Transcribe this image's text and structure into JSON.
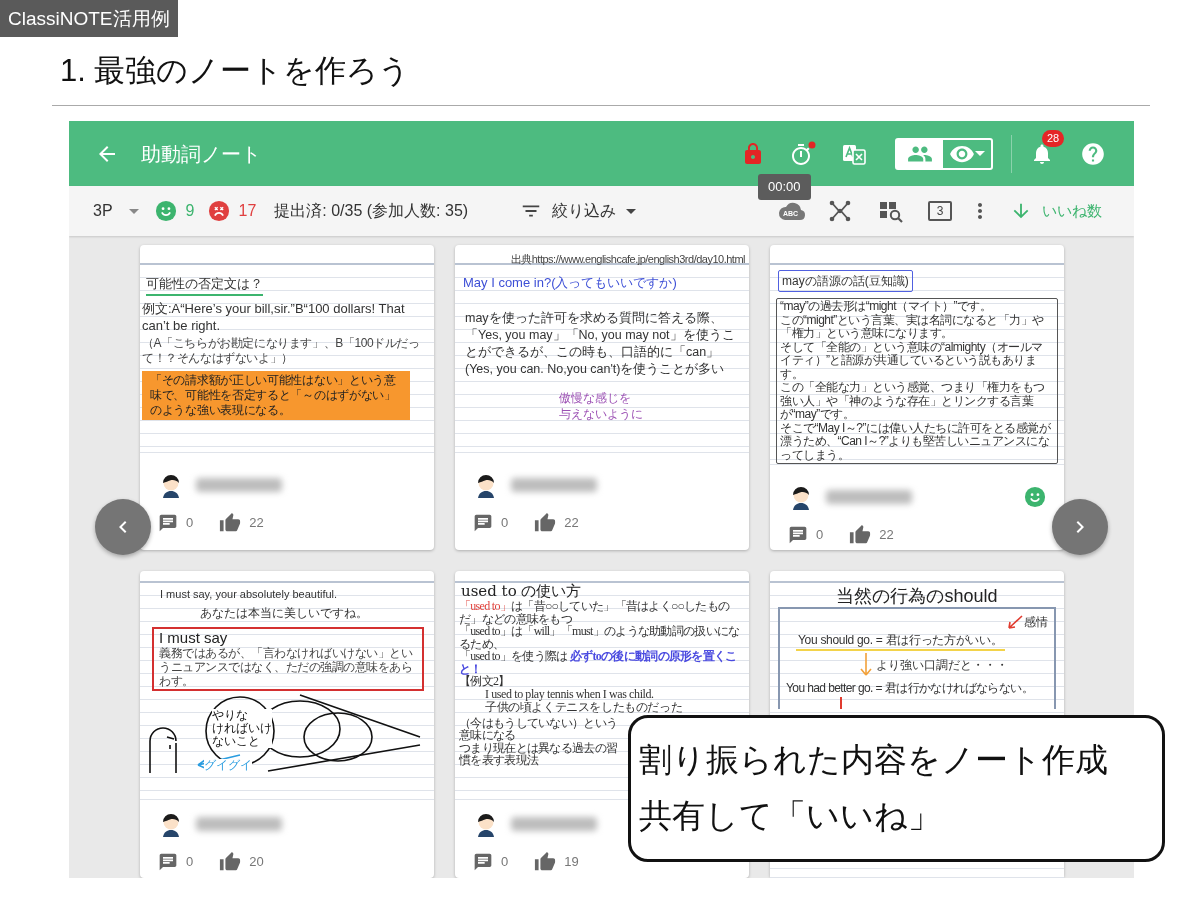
{
  "slide": {
    "tag": "ClassiNOTE活用例",
    "title": "1. 最強のノートを作ろう"
  },
  "app": {
    "header": {
      "title": "助動詞ノート",
      "view_toggle": [
        {
          "kind": "group",
          "selected": true
        },
        {
          "kind": "eye",
          "selected": false
        }
      ],
      "notifications": "28"
    },
    "tooltip": "00:00",
    "toolbar": {
      "class": "3P",
      "good_count": "9",
      "bad_count": "17",
      "submitted": "提出済: 0/35 (参加人数: 35)",
      "filter": "絞り込み",
      "cloud_label": "ABC",
      "page_count": "3",
      "sort": "いいね数"
    },
    "cards": [
      {
        "note": [
          {
            "kind": "heading-green",
            "text": "可能性の否定文は？"
          },
          {
            "kind": "body",
            "text": "例文:A“Here’s your bill,sir.”B“100 dollars! That can’t be right."
          },
          {
            "kind": "small",
            "text": "（A「こちらがお勘定になります」、B「100ドルだって！？そんなはずないよ」）"
          },
          {
            "kind": "highlight",
            "text": "「その請求額が正しい可能性はない」という意味で、可能性を否定すると「～のはずがない」のような強い表現になる。"
          }
        ],
        "footer": {
          "comments": "0",
          "likes": "22",
          "good_mark": false
        }
      },
      {
        "note": [
          {
            "kind": "source",
            "text": "出典https://www.englishcafe.jp/english3rd/day10.html"
          },
          {
            "kind": "heading-blue",
            "text": "May I come in?(入ってもいいですか)"
          },
          {
            "kind": "body-spaced",
            "text": "mayを使った許可を求める質問に答える際、「Yes, you may」「No, you may not」を使うことができるが、この時も、口語的に「can」(Yes, you can. No,you can't)を使うことが多い"
          },
          {
            "kind": "aside",
            "lines": [
              "傲慢な感じを",
              "与えないように"
            ]
          }
        ],
        "footer": {
          "comments": "0",
          "likes": "22",
          "good_mark": false
        }
      },
      {
        "note": [
          {
            "kind": "tag",
            "text": "mayの語源の話(豆知識)"
          },
          {
            "kind": "framed",
            "lines": [
              "“may”の過去形は“might（マイト）”です。",
              "この“might”という言葉、実は名詞になると「力」や「権力」という意味になります。",
              "そして「全能の」という意味の“almighty（オールマイティ）”と語源が共通しているという説もあります。",
              "この「全能な力」という感覚、つまり「権力をもつ強い人」や「神のような存在」とリンクする言葉が“may”です。",
              "そこで“May I～?”には偉い人たちに許可をとる感覚が漂うため、“Can I～?”よりも堅苦しいニュアンスになってしまう。"
            ]
          }
        ],
        "footer": {
          "comments": "0",
          "likes": "22",
          "good_mark": true
        }
      },
      {
        "note": [
          {
            "kind": "english",
            "text": "I must say, your absolutely beautiful."
          },
          {
            "kind": "translation",
            "text": "あなたは本当に美しいですね。"
          },
          {
            "kind": "red-box",
            "heading": "I must say",
            "text": "義務ではあるが、「言わなければいけない」というニュアンスではなく、ただの強調の意味をあらわす。"
          },
          {
            "kind": "sketch",
            "lines": [
              "やりな",
              "ければいけ",
              "ないこと"
            ],
            "label": "グイグイ"
          }
        ],
        "footer": {
          "comments": "0",
          "likes": "20",
          "good_mark": false
        }
      },
      {
        "note": [
          {
            "kind": "heading-serif",
            "text": "used to の使い方"
          },
          {
            "kind": "serif",
            "lead": "「used to」",
            "text": "は「昔○○していた」「昔はよく○○したものだ」などの意味をもつ"
          },
          {
            "kind": "serif",
            "text": "「used to」は「will」「must」のような助動詞の扱いになるため、"
          },
          {
            "kind": "serif",
            "text": "「used to」を使う際は ",
            "emphasis": "必ずtoの後に動詞の原形を置くこと！"
          },
          {
            "kind": "serif-label",
            "text": "【例文2】"
          },
          {
            "kind": "serif-example",
            "text": "I used to play tennis when I was child."
          },
          {
            "kind": "serif-example",
            "text": "子供の頃よくテニスをしたものだった"
          },
          {
            "kind": "serif-small",
            "text": "（今はもうしていない）という意味になる"
          },
          {
            "kind": "serif-cut",
            "text": "つまり現在とは異なる過去の習慣を表す表現法"
          }
        ],
        "footer": {
          "comments": "0",
          "likes": "19",
          "good_mark": false
        }
      },
      {
        "note": [
          {
            "kind": "diagram",
            "title": "当然の行為のshould",
            "emotion": "感情",
            "first": "You should go. = 君は行った方がいい。",
            "middle": "より強い口調だと・・・",
            "second": "You had better go. = 君は行かなければならない。"
          }
        ]
      }
    ]
  },
  "callout": {
    "lines": [
      "割り振られた内容をノート作成",
      "共有して「いいね」"
    ]
  }
}
